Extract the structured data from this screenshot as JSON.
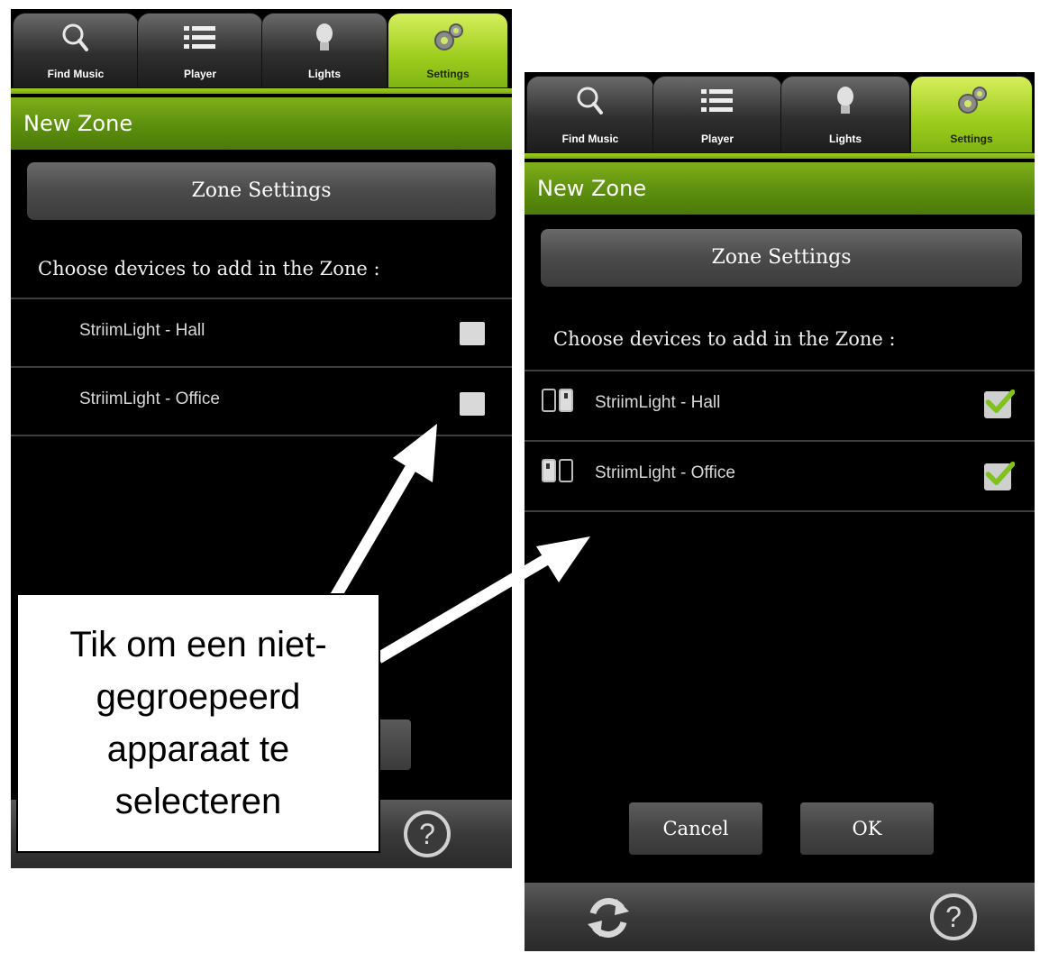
{
  "tabs": [
    {
      "label": "Find Music",
      "icon": "search-icon"
    },
    {
      "label": "Player",
      "icon": "list-icon"
    },
    {
      "label": "Lights",
      "icon": "lightbulb-icon"
    },
    {
      "label": "Settings",
      "icon": "gears-icon"
    }
  ],
  "active_tab": "Settings",
  "accent_color": "#8cc21a",
  "left": {
    "title": "New Zone",
    "zone_settings_label": "Zone Settings",
    "choose_label": "Choose devices to add in the Zone :",
    "devices": [
      {
        "label": "StriimLight - Hall",
        "checked": false
      },
      {
        "label": "StriimLight - Office",
        "checked": false
      }
    ]
  },
  "right": {
    "title": "New Zone",
    "zone_settings_label": "Zone Settings",
    "choose_label": "Choose devices to add in the Zone :",
    "devices": [
      {
        "label": "StriimLight - Hall",
        "checked": true,
        "icon": "speaker-pair-icon"
      },
      {
        "label": "StriimLight - Office",
        "checked": true,
        "icon": "speaker-pair-icon"
      }
    ],
    "cancel_label": "Cancel",
    "ok_label": "OK"
  },
  "callout": {
    "text": "Tik om een niet-gegroepeerd apparaat te selecteren"
  }
}
